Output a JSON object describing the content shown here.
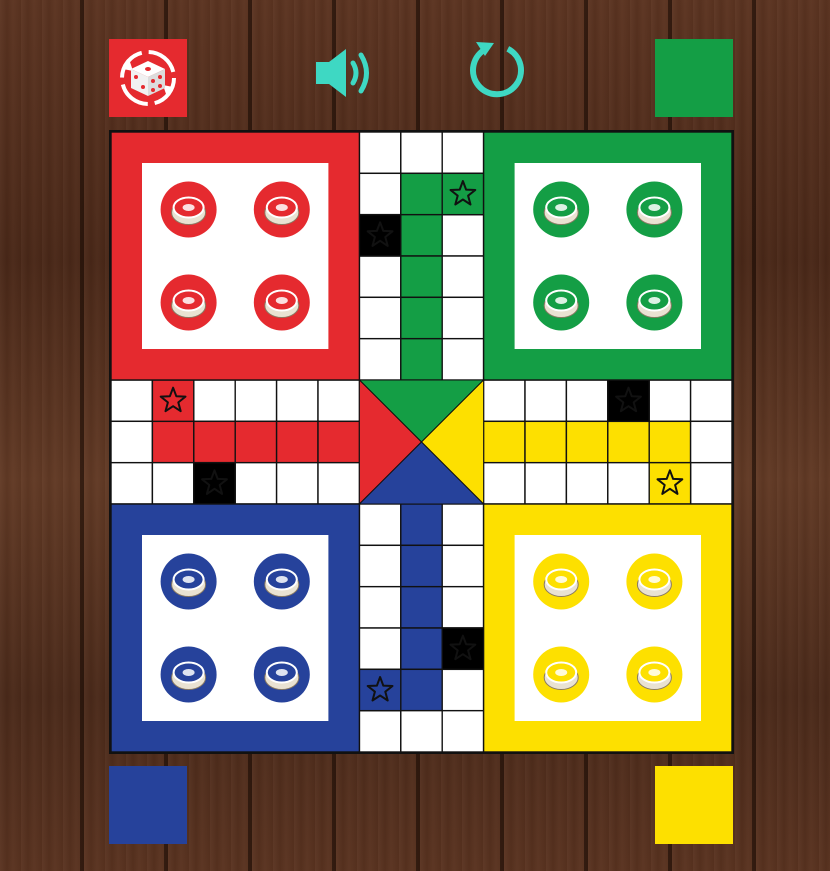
{
  "toolbar": {
    "dice_icon": "dice-refresh-icon",
    "sound_icon": "speaker-volume-icon",
    "restart_icon": "restart-icon"
  },
  "colors": {
    "red": "#e52a2f",
    "green": "#149e45",
    "blue": "#26429b",
    "yellow": "#fde000",
    "icon_teal": "#3ed8c3",
    "board_white": "#ffffff",
    "grid_line": "#111111"
  },
  "players": [
    {
      "color": "green",
      "corner": "top-right"
    },
    {
      "color": "blue",
      "corner": "bottom-left"
    },
    {
      "color": "yellow",
      "corner": "bottom-right"
    }
  ],
  "yards": [
    {
      "color": "red",
      "corner": "top-left",
      "tokens": 4
    },
    {
      "color": "green",
      "corner": "top-right",
      "tokens": 4
    },
    {
      "color": "blue",
      "corner": "bottom-left",
      "tokens": 4
    },
    {
      "color": "yellow",
      "corner": "bottom-right",
      "tokens": 4
    }
  ],
  "safe_squares": [
    {
      "col": 8,
      "row": 1,
      "fill": "green"
    },
    {
      "col": 6,
      "row": 2,
      "fill": "white"
    },
    {
      "col": 1,
      "row": 6,
      "fill": "red"
    },
    {
      "col": 2,
      "row": 8,
      "fill": "white"
    },
    {
      "col": 12,
      "row": 6,
      "fill": "white"
    },
    {
      "col": 13,
      "row": 8,
      "fill": "yellow"
    },
    {
      "col": 8,
      "row": 12,
      "fill": "white"
    },
    {
      "col": 6,
      "row": 13,
      "fill": "blue"
    }
  ]
}
